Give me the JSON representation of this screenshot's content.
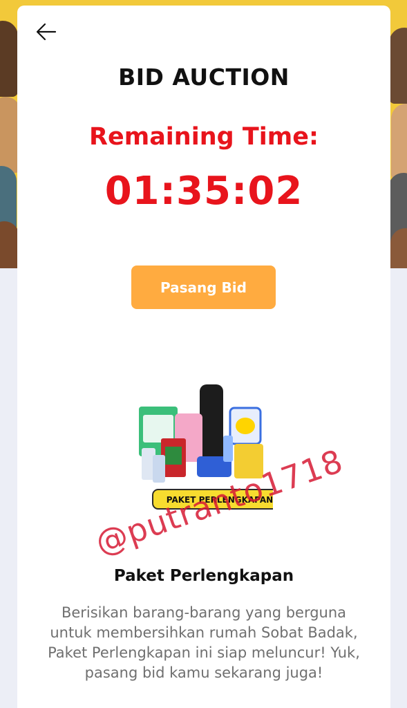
{
  "header": {
    "back_icon": "arrow-left-icon",
    "title": "BID AUCTION"
  },
  "timer": {
    "label": "Remaining Time:",
    "value": "01:35:02"
  },
  "actions": {
    "bid_button_label": "Pasang Bid"
  },
  "product": {
    "image_label": "PAKET PERLENGKAPAN",
    "name": "Paket Perlengkapan",
    "description": "Berisikan barang-barang yang berguna untuk membersihkan rumah Sobat Badak, Paket Perlengkapan ini siap meluncur! Yuk, pasang bid kamu sekarang juga!"
  },
  "watermark": "@putranto1718",
  "colors": {
    "accent_red": "#e8141c",
    "button_orange": "#ffab40",
    "banner_yellow": "#f2c93a"
  }
}
